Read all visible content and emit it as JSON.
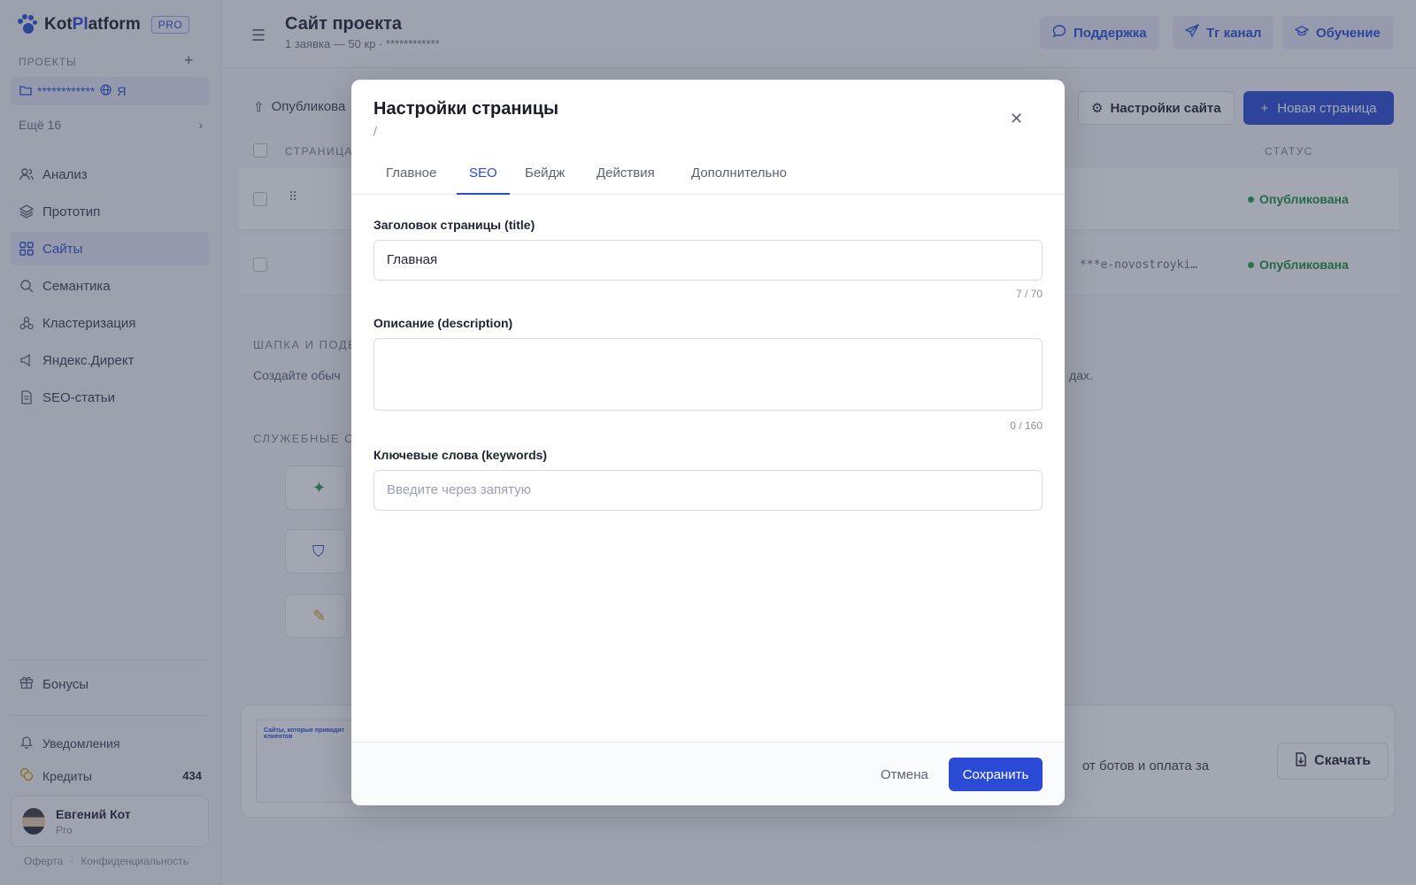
{
  "sidebar": {
    "logo": {
      "kot": "Kot",
      "pl": "Pl",
      "atform": "atform",
      "badge": "PRO"
    },
    "projects_label": "ПРОЕКТЫ",
    "project": {
      "name": "************",
      "suffix": "Я"
    },
    "more": "Ещё 16",
    "nav": [
      {
        "label": "Анализ",
        "icon": "users-icon"
      },
      {
        "label": "Прототип",
        "icon": "layers-icon"
      },
      {
        "label": "Сайты",
        "icon": "grid-icon",
        "active": true
      },
      {
        "label": "Семантика",
        "icon": "search-icon"
      },
      {
        "label": "Кластеризация",
        "icon": "cluster-icon"
      },
      {
        "label": "Яндекс.Директ",
        "icon": "megaphone-icon"
      },
      {
        "label": "SEO-статьи",
        "icon": "document-icon"
      }
    ],
    "bonuses": "Бонусы",
    "notifications": "Уведомления",
    "credits_label": "Кредиты",
    "credits_count": "434",
    "user": {
      "name": "Евгений Кот",
      "plan": "Pro"
    },
    "footer": {
      "offer": "Оферта",
      "sep": "·",
      "privacy": "Конфиденциальность"
    }
  },
  "topbar": {
    "title": "Сайт проекта",
    "subtitle": "1 заявка — 50 кр · ************",
    "support": "Поддержка",
    "tg": "Тг канал",
    "learning": "Обучение"
  },
  "content": {
    "publish_label": "Опубликова",
    "site_settings": "Настройки сайта",
    "new_page": "Новая страница",
    "col_pages": "СТРАНИЦА",
    "col_status": "СТАТУС",
    "rows": [
      {
        "url": "",
        "status": "Опубликована"
      },
      {
        "url": "***e-novostroyki…",
        "status": "Опубликована"
      }
    ],
    "header_footer_label": "ШАПКА И ПОДВ",
    "header_footer_text": "Создайте обыч",
    "header_footer_text_end": "дах.",
    "service_label": "СЛУЖЕБНЫЕ СТ",
    "promo_text": "от ботов и оплата за",
    "download": "Скачать",
    "promo_thumb_title": "Сайты, которые приводят клиентов"
  },
  "modal": {
    "title": "Настройки страницы",
    "path": "/",
    "tabs": [
      "Главное",
      "SEO",
      "Бейдж",
      "Действия",
      "Дополнительно"
    ],
    "active_tab": "SEO",
    "title_label": "Заголовок страницы (title)",
    "title_value": "Главная",
    "title_counter": "7 / 70",
    "description_label": "Описание (description)",
    "description_value": "",
    "description_counter": "0 / 160",
    "keywords_label": "Ключевые слова (keywords)",
    "keywords_placeholder": "Введите через запятую",
    "cancel": "Отмена",
    "save": "Сохранить"
  },
  "colors": {
    "accent": "#2b4bd6",
    "success": "#22a04a",
    "overlay": "rgba(52,60,84,0.45)"
  }
}
